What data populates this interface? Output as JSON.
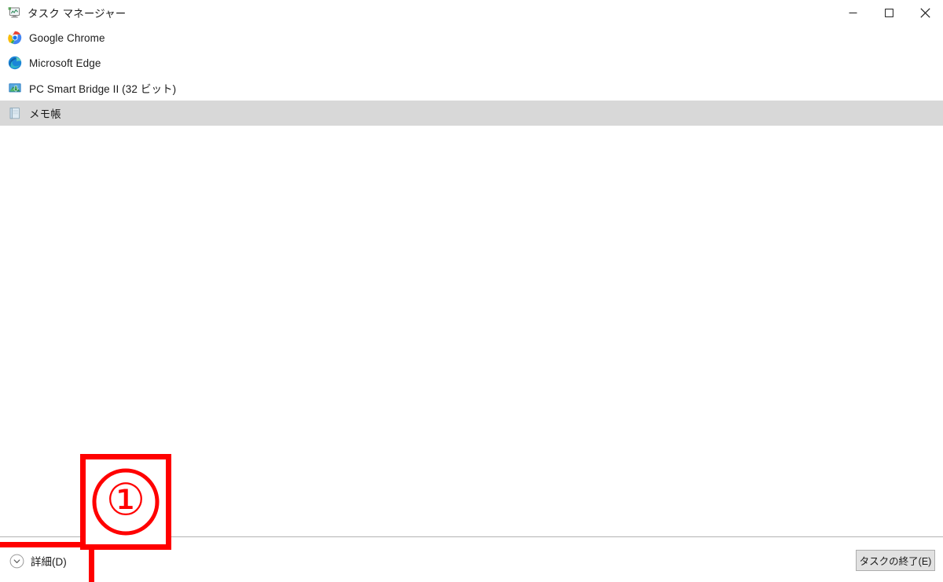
{
  "window": {
    "title": "タスク マネージャー",
    "app_icon": "task-manager-icon",
    "controls": {
      "minimize": "−",
      "maximize": "□",
      "close": "✕"
    }
  },
  "process_list": {
    "rows": [
      {
        "label": "Google Chrome",
        "icon": "chrome-icon",
        "selected": false
      },
      {
        "label": "Microsoft Edge",
        "icon": "edge-icon",
        "selected": false
      },
      {
        "label": "PC Smart Bridge II (32 ビット)",
        "icon": "pc-smart-bridge-icon",
        "selected": false
      },
      {
        "label": "メモ帳",
        "icon": "notepad-icon",
        "selected": true
      }
    ]
  },
  "footer": {
    "details_label": "詳細(D)",
    "details_icon": "chevron-down-circle-icon",
    "end_task_label": "タスクの終了(E)"
  },
  "annotation": {
    "number": "①",
    "color": "#ff0000"
  },
  "colors": {
    "selection": "#d8d8d8",
    "separator": "#b3b3b3",
    "text": "#1b1b1b",
    "button_face": "#e1e1e1",
    "button_border": "#adadad",
    "annotation_red": "#ff0000"
  }
}
